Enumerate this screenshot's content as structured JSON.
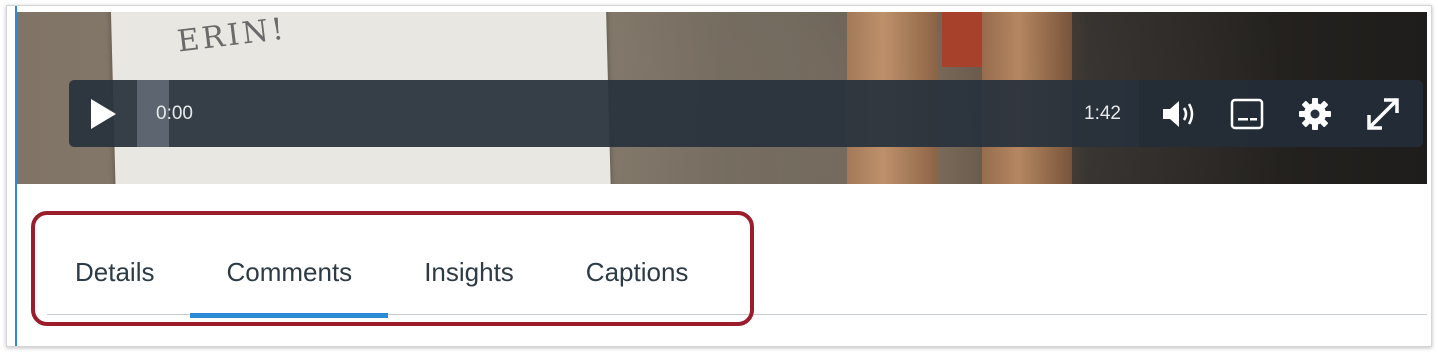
{
  "player": {
    "current_time": "0:00",
    "duration": "1:42",
    "progress_fraction": 0.0,
    "video_scribble": "ERIN!",
    "icons": [
      "play-icon",
      "volume-icon",
      "captions-icon",
      "settings-icon",
      "fullscreen-icon"
    ]
  },
  "tabs": [
    {
      "label": "Details",
      "active": false
    },
    {
      "label": "Comments",
      "active": true
    },
    {
      "label": "Insights",
      "active": false
    },
    {
      "label": "Captions",
      "active": false
    }
  ],
  "colors": {
    "accent": "#2d8ad6",
    "highlight": "#9b1c2b",
    "tab_text": "#2d3b45",
    "control_bar": "#28313c"
  }
}
